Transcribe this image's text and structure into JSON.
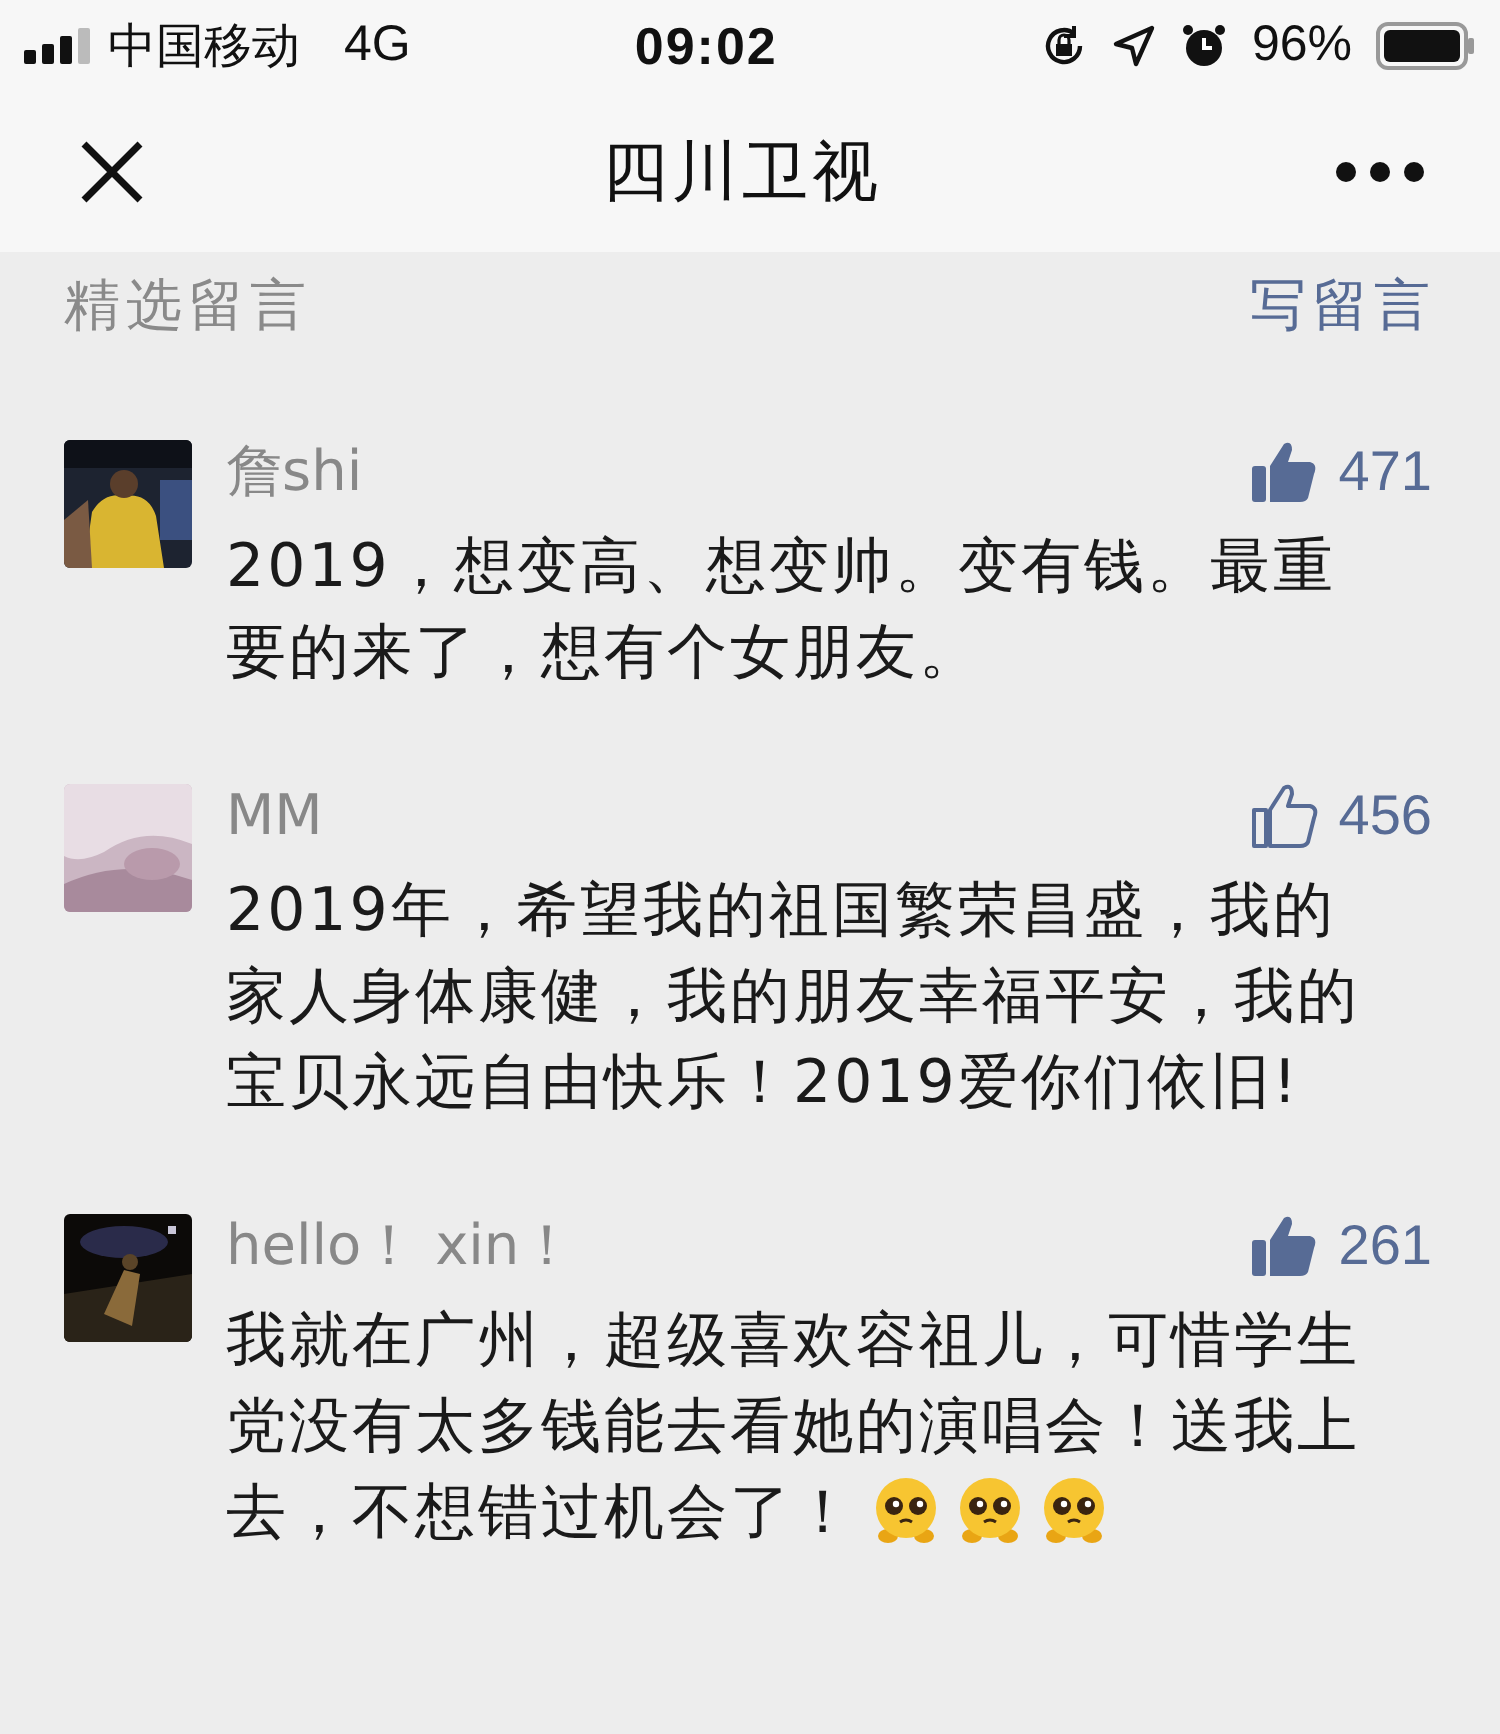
{
  "status_bar": {
    "carrier": "中国移动",
    "network": "4G",
    "time": "09:02",
    "battery": "96%"
  },
  "nav": {
    "title": "四川卫视"
  },
  "section": {
    "title": "精选留言",
    "action": "写留言"
  },
  "comments": [
    {
      "name": "詹shi",
      "liked": true,
      "likes": "471",
      "text": "2019，想变高、想变帅。变有钱。最重要的来了，想有个女朋友。"
    },
    {
      "name": "MM",
      "liked": false,
      "likes": "456",
      "text": "2019年，希望我的祖国繁荣昌盛，我的家人身体康健，我的朋友幸福平安，我的宝贝永远自由快乐！2019爱你们依旧!"
    },
    {
      "name": "hello！ xin！",
      "liked": true,
      "likes": "261",
      "text": "我就在广州，超级喜欢容祖儿，可惜学生党没有太多钱能去看她的演唱会！送我上去，不想错过机会了！",
      "emojis": [
        {
          "kind": "emoji"
        },
        {
          "kind": "emoji"
        },
        {
          "kind": "emoji"
        }
      ]
    }
  ]
}
